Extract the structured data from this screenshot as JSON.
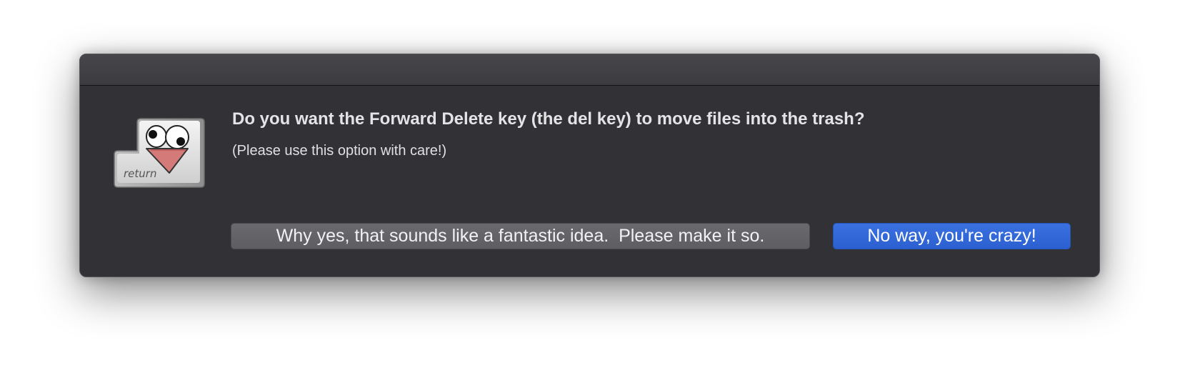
{
  "dialog": {
    "title": "Do you want the Forward Delete key (the del key) to move files into the trash?",
    "subtitle": "(Please use this option with care!)",
    "icon": {
      "name": "return-key-face-icon",
      "key_label": "return"
    },
    "buttons": {
      "secondary_label": "Why yes, that sounds like a fantastic idea.  Please make it so.",
      "primary_label": "No way, you're crazy!"
    }
  },
  "colors": {
    "window_bg": "#323236",
    "primary_button": "#2f64d6",
    "secondary_button": "#646468",
    "text": "#e4e4e6"
  }
}
